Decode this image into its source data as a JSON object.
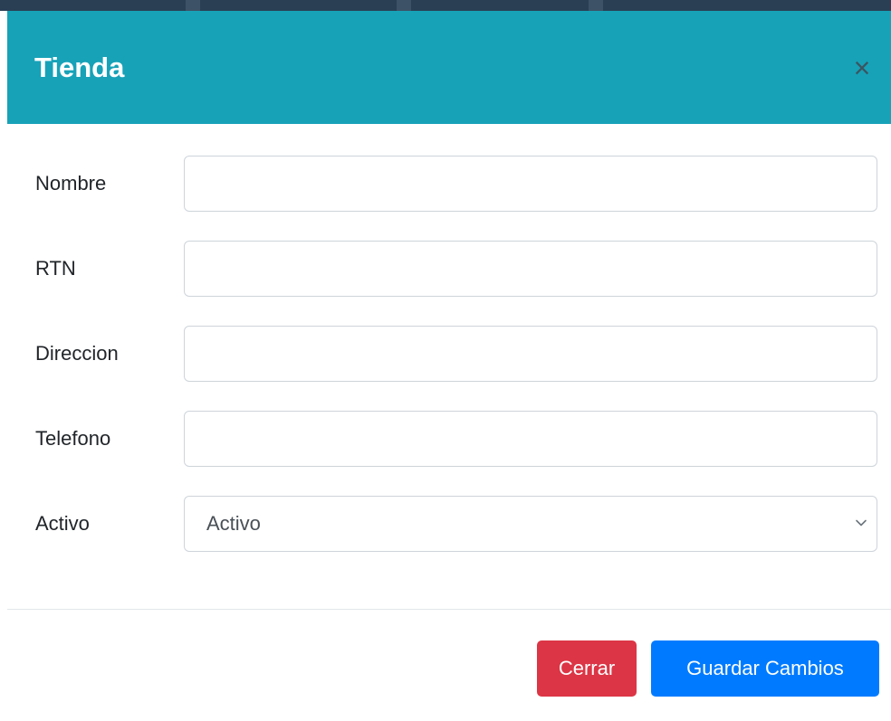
{
  "modal": {
    "title": "Tienda",
    "close_glyph": "×",
    "header_color": "#17a2b8"
  },
  "form": {
    "fields": [
      {
        "label": "Nombre",
        "value": "",
        "type": "text"
      },
      {
        "label": "RTN",
        "value": "",
        "type": "text"
      },
      {
        "label": "Direccion",
        "value": "",
        "type": "text"
      },
      {
        "label": "Telefono",
        "value": "",
        "type": "text"
      }
    ],
    "activo": {
      "label": "Activo",
      "selected": "Activo"
    }
  },
  "footer": {
    "close_label": "Cerrar",
    "close_color": "#dc3545",
    "save_label": "Guardar Cambios",
    "save_color": "#007bff"
  },
  "icons": {
    "close": "close-icon",
    "select_arrow": "chevron-down-icon"
  }
}
